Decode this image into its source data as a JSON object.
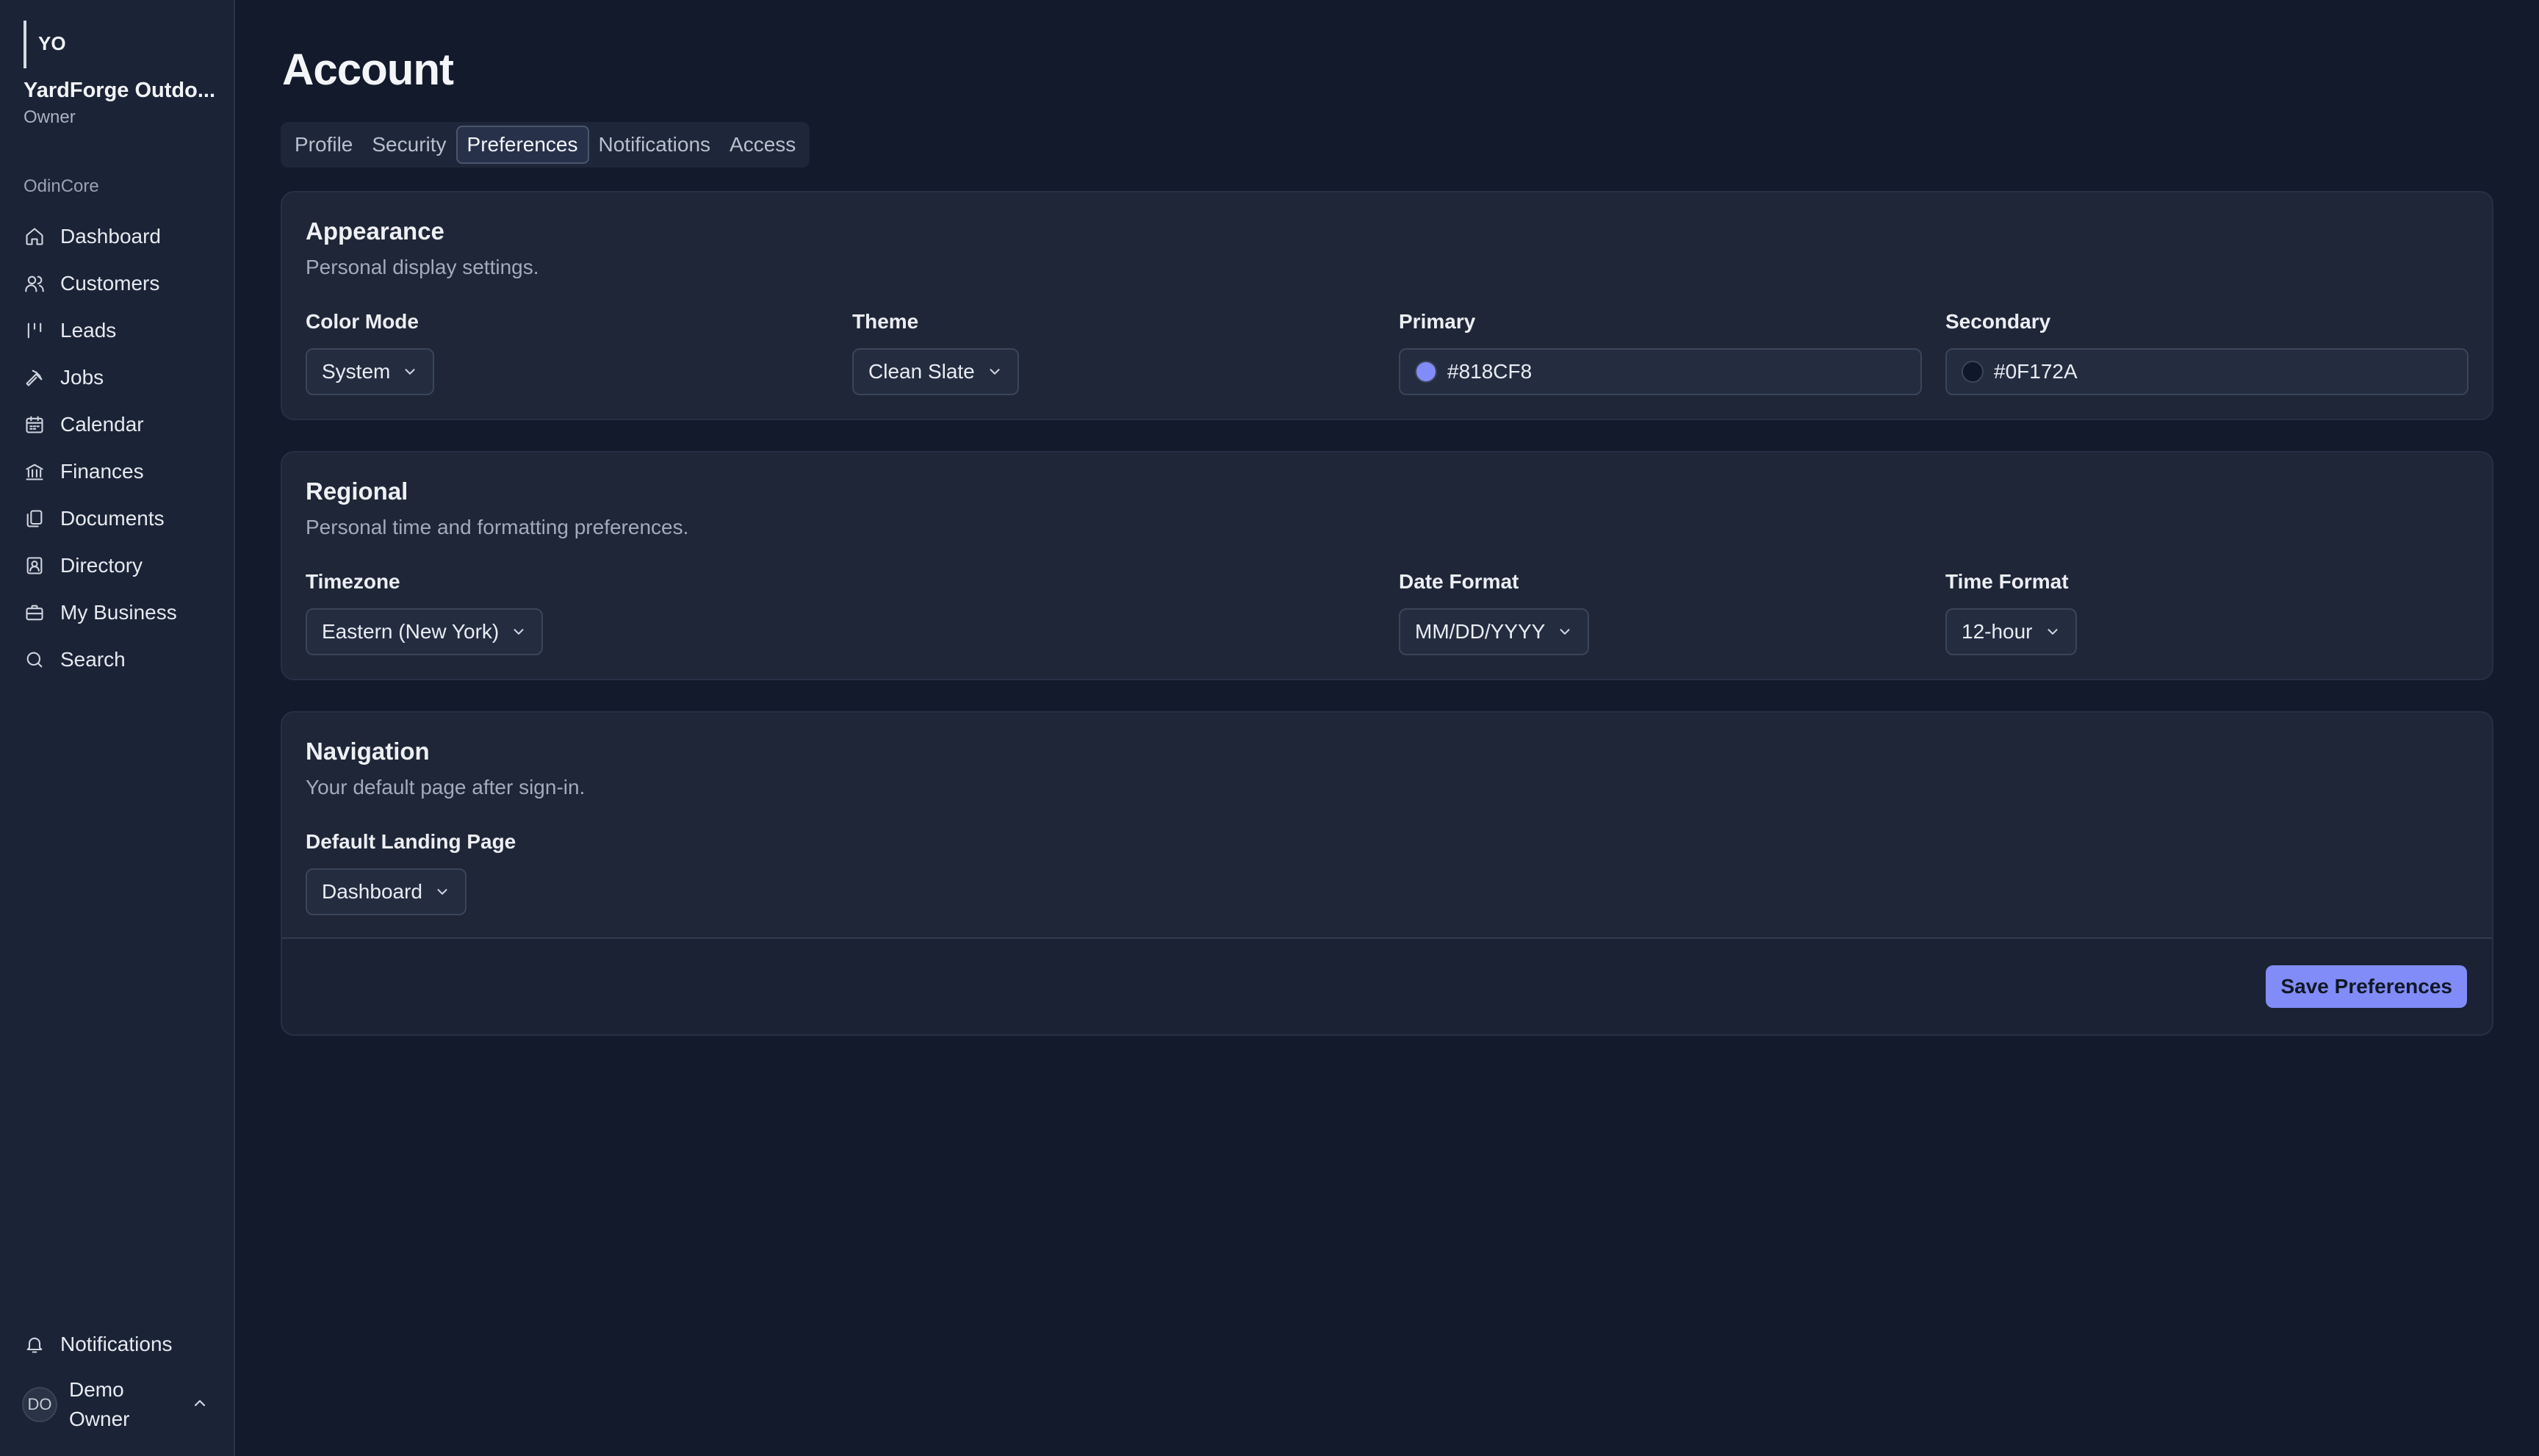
{
  "sidebar": {
    "org_initials": "YO",
    "org_name": "YardForge Outdo...",
    "org_role": "Owner",
    "section_label": "OdinCore",
    "items": [
      {
        "label": "Dashboard",
        "icon": "home-icon"
      },
      {
        "label": "Customers",
        "icon": "users-icon"
      },
      {
        "label": "Leads",
        "icon": "leads-icon"
      },
      {
        "label": "Jobs",
        "icon": "hammer-icon"
      },
      {
        "label": "Calendar",
        "icon": "calendar-icon"
      },
      {
        "label": "Finances",
        "icon": "bank-icon"
      },
      {
        "label": "Documents",
        "icon": "documents-icon"
      },
      {
        "label": "Directory",
        "icon": "contact-book-icon"
      },
      {
        "label": "My Business",
        "icon": "briefcase-icon"
      },
      {
        "label": "Search",
        "icon": "search-icon"
      }
    ],
    "notifications_label": "Notifications",
    "user": {
      "initials": "DO",
      "name": "Demo Owner"
    }
  },
  "page": {
    "title": "Account",
    "tabs": [
      "Profile",
      "Security",
      "Preferences",
      "Notifications",
      "Access"
    ],
    "active_tab": "Preferences"
  },
  "appearance": {
    "title": "Appearance",
    "description": "Personal display settings.",
    "color_mode_label": "Color Mode",
    "color_mode_value": "System",
    "theme_label": "Theme",
    "theme_value": "Clean Slate",
    "primary_label": "Primary",
    "primary_value": "#818CF8",
    "primary_color": "#818CF8",
    "secondary_label": "Secondary",
    "secondary_value": "#0F172A",
    "secondary_color": "#0F172A"
  },
  "regional": {
    "title": "Regional",
    "description": "Personal time and formatting preferences.",
    "timezone_label": "Timezone",
    "timezone_value": "Eastern (New York)",
    "date_format_label": "Date Format",
    "date_format_value": "MM/DD/YYYY",
    "time_format_label": "Time Format",
    "time_format_value": "12-hour"
  },
  "navigation": {
    "title": "Navigation",
    "description": "Your default page after sign-in.",
    "landing_label": "Default Landing Page",
    "landing_value": "Dashboard",
    "save_label": "Save Preferences"
  },
  "colors": {
    "accent": "#818CF8",
    "background": "#121A2B",
    "card": "#1E2637"
  }
}
